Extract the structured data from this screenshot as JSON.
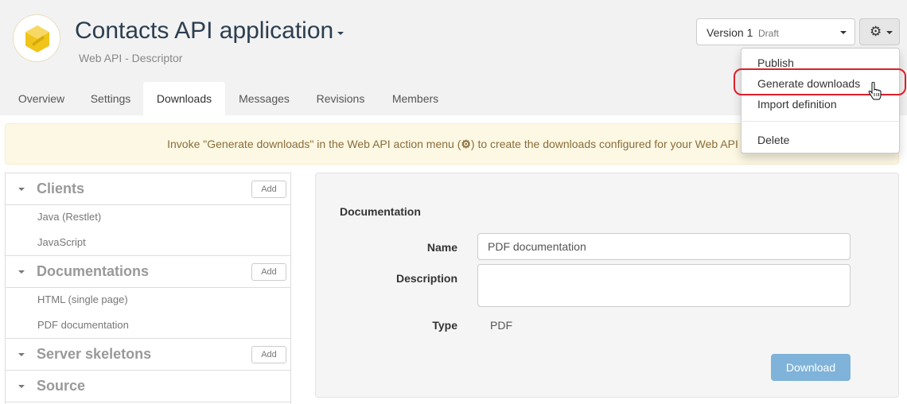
{
  "app": {
    "title": "Contacts API application",
    "subtitle": "Web API - Descriptor",
    "logo_icon": "hexagon-logo-icon"
  },
  "version": {
    "label": "Version 1",
    "status": "Draft"
  },
  "actions": {
    "icon": "gear-icon"
  },
  "tabs": [
    {
      "label": "Overview",
      "active": false
    },
    {
      "label": "Settings",
      "active": false
    },
    {
      "label": "Downloads",
      "active": true
    },
    {
      "label": "Messages",
      "active": false
    },
    {
      "label": "Revisions",
      "active": false
    },
    {
      "label": "Members",
      "active": false
    }
  ],
  "alert": {
    "before": "Invoke \"Generate downloads\" in the Web API action menu (",
    "after": ") to create the downloads configured for your Web API"
  },
  "sidebar": {
    "groups": [
      {
        "title": "Clients",
        "add_label": "Add",
        "items": [
          "Java (Restlet)",
          "JavaScript"
        ]
      },
      {
        "title": "Documentations",
        "add_label": "Add",
        "items": [
          "HTML (single page)",
          "PDF documentation"
        ]
      },
      {
        "title": "Server skeletons",
        "add_label": "Add",
        "items": []
      },
      {
        "title": "Source",
        "add_label": "",
        "items": []
      }
    ]
  },
  "form": {
    "section_title": "Documentation",
    "name_label": "Name",
    "name_value": "PDF documentation",
    "description_label": "Description",
    "description_value": "",
    "type_label": "Type",
    "type_value": "PDF",
    "download_label": "Download"
  },
  "menu": {
    "items": [
      "Publish",
      "Generate downloads",
      "Import definition",
      "Delete"
    ],
    "highlighted": "Generate downloads"
  },
  "colors": {
    "brand": "#f0c419",
    "highlight": "#dd1f2a",
    "alert_bg": "#fcf8e3",
    "primary_button": "#7fb3d9"
  }
}
